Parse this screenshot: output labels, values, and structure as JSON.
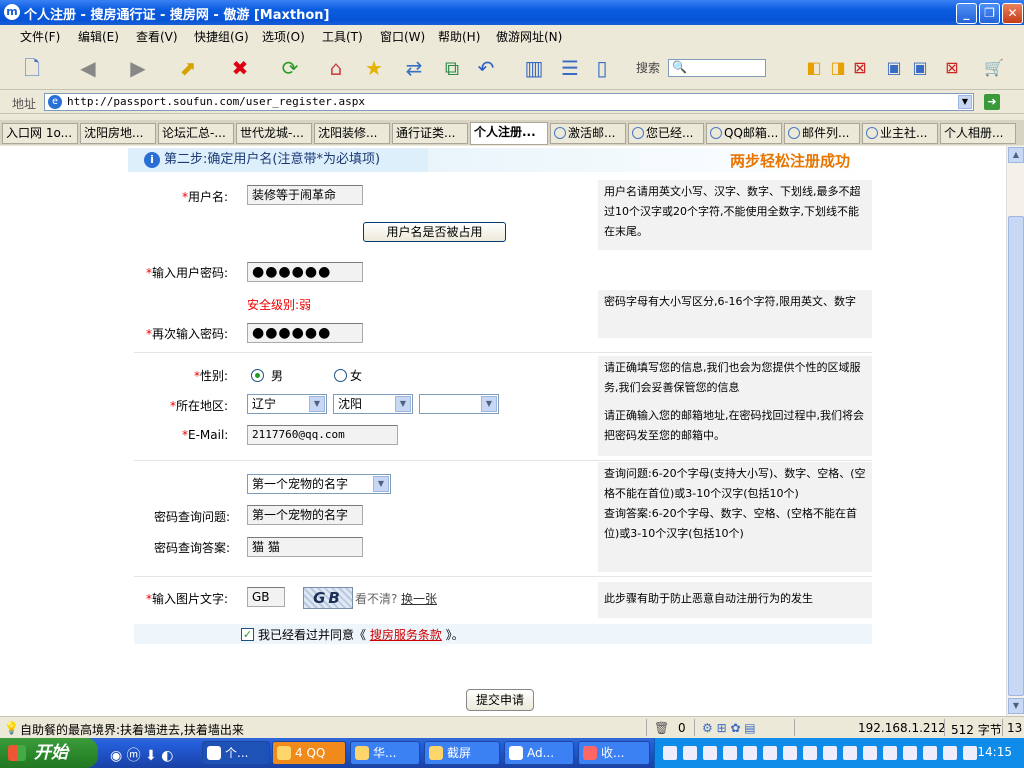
{
  "window": {
    "title": "个人注册 - 搜房通行证 - 搜房网 - 傲游 [Maxthon]"
  },
  "menu": [
    "文件(F)",
    "编辑(E)",
    "查看(V)",
    "快捷组(G)",
    "选项(O)",
    "工具(T)",
    "窗口(W)",
    "帮助(H)",
    "傲游网址(N)"
  ],
  "toolbar": {
    "search_label": "搜索"
  },
  "address": {
    "label": "地址",
    "url": "http://passport.soufun.com/user_register.aspx"
  },
  "tabs": [
    {
      "label": "入口网 1o..."
    },
    {
      "label": "沈阳房地..."
    },
    {
      "label": "论坛汇总-..."
    },
    {
      "label": "世代龙城-..."
    },
    {
      "label": "沈阳装修..."
    },
    {
      "label": "通行证类..."
    },
    {
      "label": "个人注册..."
    },
    {
      "label": "激活邮..."
    },
    {
      "label": "您已经..."
    },
    {
      "label": "QQ邮箱..."
    },
    {
      "label": "邮件列..."
    },
    {
      "label": "业主社..."
    },
    {
      "label": "个人相册..."
    }
  ],
  "form": {
    "step_title": "第二步:确定用户名(注意带*为必填项)",
    "slogan": "两步轻松注册成功",
    "username_label": "用户名:",
    "username_value": "装修等于闹革命",
    "check_button": "用户名是否被占用",
    "username_help": "用户名请用英文小写、汉字、数字、下划线,最多不超过10个汉字或20个字符,不能使用全数字,下划线不能在末尾。",
    "password_label": "输入用户密码:",
    "password_value": "●●●●●●",
    "security_level": "安全级别:弱",
    "password_confirm_label": "再次输入密码:",
    "password_confirm_value": "●●●●●●",
    "password_help": "密码字母有大小写区分,6-16个字符,限用英文、数字",
    "gender_label": "性别:",
    "gender_male": "男",
    "gender_female": "女",
    "region_label": "所在地区:",
    "province": "辽宁",
    "city": "沈阳",
    "district": "",
    "email_label": "E-Mail:",
    "email_value": "2117760@qq.com",
    "info_help": "请正确填写您的信息,我们也会为您提供个性的区域服务,我们会妥善保管您的信息",
    "email_help": "请正确输入您的邮箱地址,在密码找回过程中,我们将会把密码发至您的邮箱中。",
    "question_select": "第一个宠物的名字",
    "question_label": "密码查询问题:",
    "question_value": "第一个宠物的名字",
    "answer_label": "密码查询答案:",
    "answer_value": "猫  猫",
    "question_help": "查询问题:6-20个字母(支持大小写)、数字、空格、(空格不能在首位)或3-10个汉字(包括10个)",
    "answer_help": "查询答案:6-20个字母、数字、空格、(空格不能在首位)或3-10个汉字(包括10个)",
    "captcha_label": "输入图片文字:",
    "captcha_value": "GB",
    "captcha_image_text": "GB",
    "captcha_unclear": "看不清?",
    "captcha_change": "换一张",
    "captcha_help": "此步骤有助于防止恶意自动注册行为的发生",
    "agree_prefix": "我已经看过并同意《",
    "agree_link": "搜房服务条款",
    "agree_suffix": "》。",
    "submit_button": "提交申请",
    "required_mark": "*"
  },
  "status": {
    "message": "自助餐的最高境界:扶着墙进去,扶着墙出来",
    "count": "0",
    "ip": "192.168.1.212",
    "bytes": "512 字节",
    "extra": "13"
  },
  "taskbar": {
    "start": "开始",
    "tasks": [
      "个...",
      "4 QQ",
      "华...",
      "截屏",
      "Ad...",
      "收..."
    ],
    "clock": "14:15"
  },
  "colors": {
    "accent": "#0a5ce0",
    "required": "#ee0000",
    "slogan": "#e87500",
    "link": "#cc0000"
  }
}
